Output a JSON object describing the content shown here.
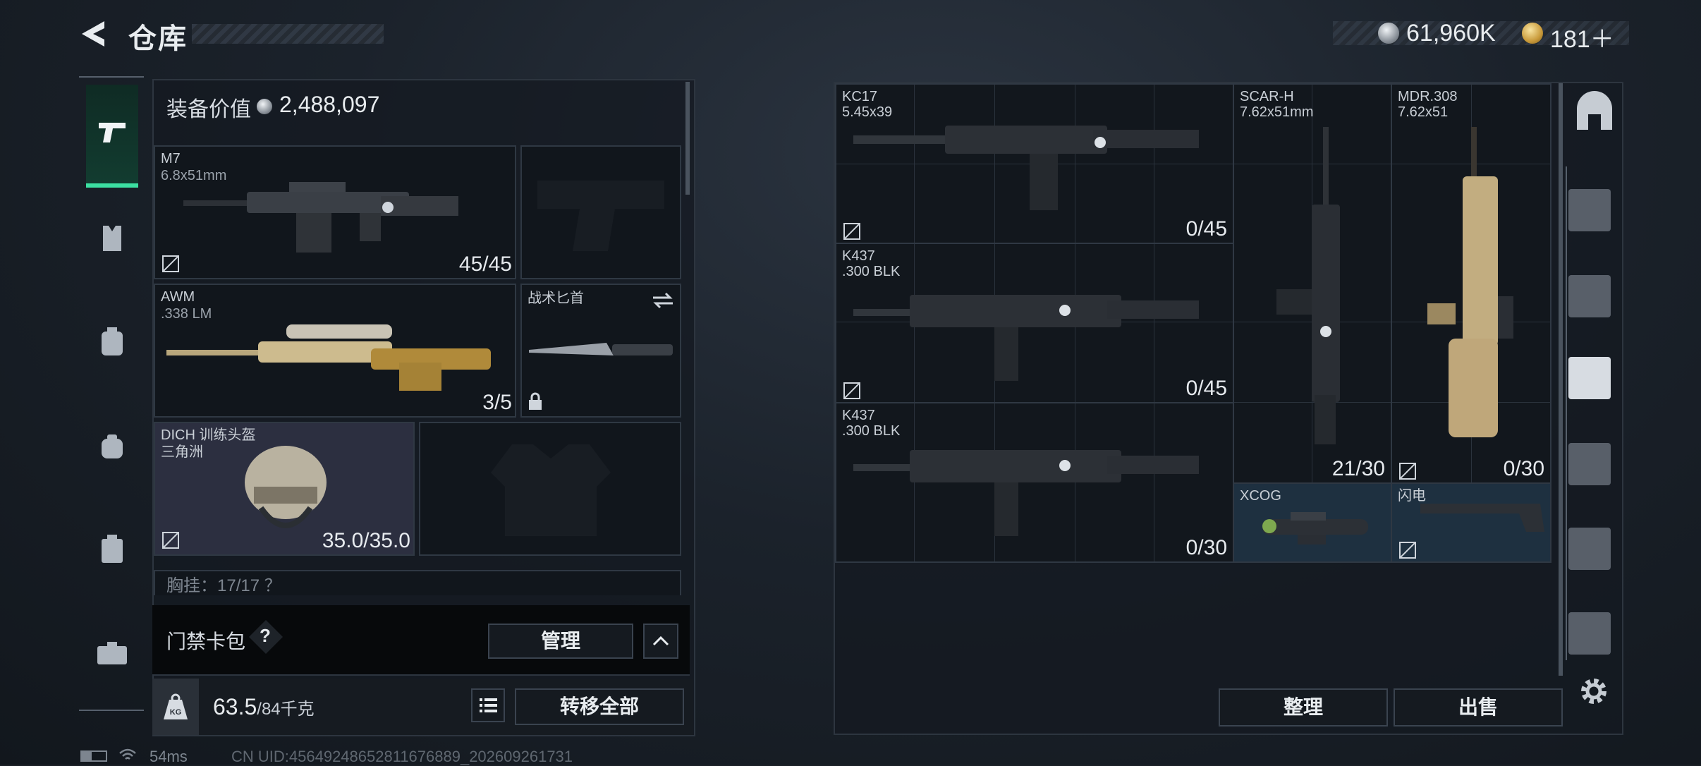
{
  "header": {
    "title": "仓库"
  },
  "currency": {
    "silver": "61,960K",
    "gold": "181＋"
  },
  "equip": {
    "value_label": "装备价值",
    "value": "2,488,097"
  },
  "loadout": {
    "primary1": {
      "name": "M7",
      "ammo": "6.8x51mm",
      "count": "45/45"
    },
    "primary2": {
      "name": "AWM",
      "ammo": ".338 LM",
      "count": "3/5"
    },
    "melee": {
      "name": "战术匕首"
    },
    "helmet": {
      "name": "DICH 训练头盔",
      "sub": "三角洲",
      "durability": "35.0/35.0"
    },
    "chest_partial": "胸挂：17/17 ？"
  },
  "keycard": {
    "label": "门禁卡包",
    "help": "?",
    "manage": "管理"
  },
  "weight": {
    "current": "63.5",
    "max": "/84千克",
    "kg_icon_text": "KG",
    "transfer_all": "转移全部"
  },
  "stash": {
    "items": [
      {
        "name": "KC17",
        "ammo": "5.45x39",
        "count": "0/45"
      },
      {
        "name": "K437",
        "ammo": ".300 BLK",
        "count": "0/45"
      },
      {
        "name": "K437",
        "ammo": ".300 BLK",
        "count": "0/30"
      },
      {
        "name": "SCAR-H",
        "ammo": "7.62x51mm",
        "count": "21/30"
      },
      {
        "name": "MDR.308",
        "ammo": "7.62x51",
        "count": "0/30"
      },
      {
        "name": "XCOG",
        "ammo": "",
        "count": ""
      },
      {
        "name": "闪电",
        "ammo": "",
        "count": ""
      }
    ]
  },
  "actions": {
    "sort": "整理",
    "sell": "出售"
  },
  "status": {
    "ping": "54ms",
    "uid": "CN UID:4564924865281167​6889_202609261731"
  },
  "colors": {
    "accent": "#3ce0a2",
    "bg": "#1a1f26"
  }
}
